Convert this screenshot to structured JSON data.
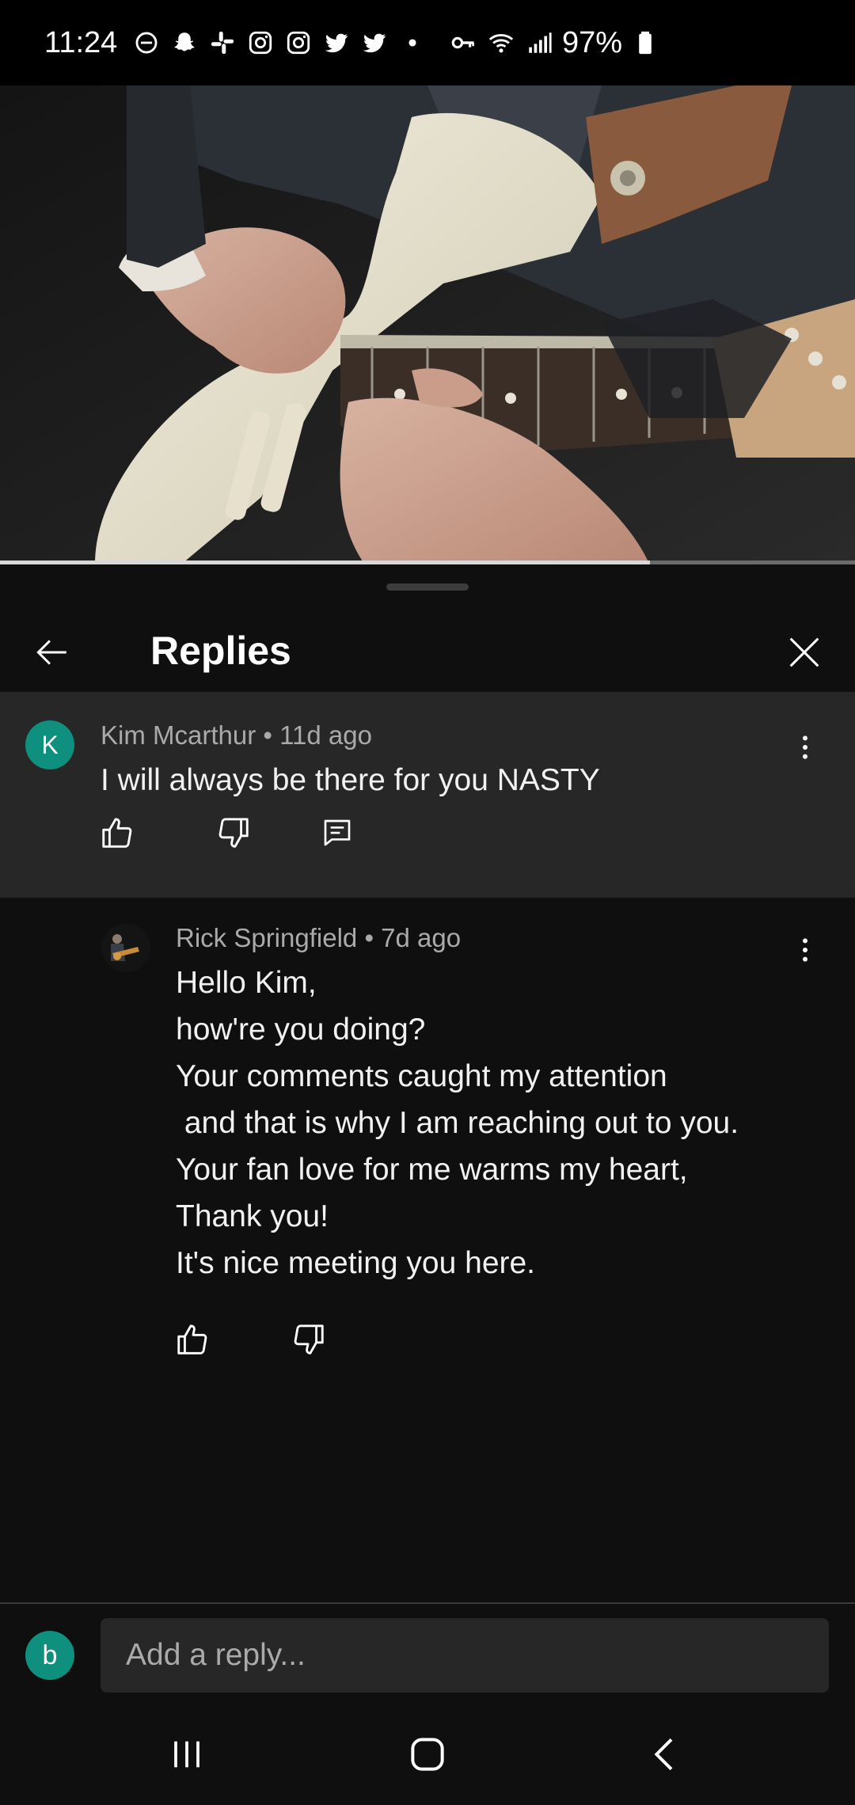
{
  "status_bar": {
    "time": "11:24",
    "battery": "97%",
    "icons_left": [
      "do-not-disturb-icon",
      "snapchat-icon",
      "slack-icon",
      "instagram-icon",
      "instagram-icon",
      "twitter-icon",
      "twitter-icon",
      "dot-icon"
    ],
    "icons_right": [
      "vpn-key-icon",
      "wifi-icon",
      "signal-icon",
      "battery-icon"
    ]
  },
  "video": {
    "progress": 0.76
  },
  "header": {
    "title": "Replies"
  },
  "parent_comment": {
    "author": "Kim Mcarthur",
    "age": "11d ago",
    "avatar_letter": "K",
    "text": "I will always be there for you NASTY"
  },
  "reply": {
    "author": "Rick Springfield",
    "age": "7d ago",
    "lines": [
      "Hello Kim,",
      "how're you doing?",
      "Your comments caught my attention",
      " and that is why I am reaching out to you.",
      "Your fan love for me warms my heart,",
      "Thank you!",
      "It's nice meeting you here."
    ]
  },
  "reply_bar": {
    "avatar_letter": "b",
    "placeholder": "Add a reply..."
  },
  "colors": {
    "background": "#0f0f0f",
    "parent_bg": "#272727",
    "avatar_teal": "#0f8f7e",
    "meta_gray": "#aaaaaa"
  }
}
